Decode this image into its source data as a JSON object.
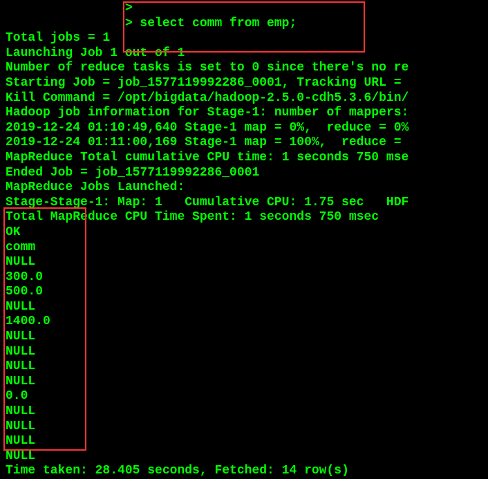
{
  "terminal": {
    "prompt1": "                >",
    "prompt2": "                > select comm from emp;",
    "lines": [
      "Total jobs = 1",
      "Launching Job 1 out of 1",
      "Number of reduce tasks is set to 0 since there's no re",
      "Starting Job = job_1577119992286_0001, Tracking URL = ",
      "Kill Command = /opt/bigdata/hadoop-2.5.0-cdh5.3.6/bin/",
      "Hadoop job information for Stage-1: number of mappers:",
      "2019-12-24 01:10:49,640 Stage-1 map = 0%,  reduce = 0%",
      "2019-12-24 01:11:00,169 Stage-1 map = 100%,  reduce = ",
      "MapReduce Total cumulative CPU time: 1 seconds 750 mse",
      "Ended Job = job_1577119992286_0001",
      "MapReduce Jobs Launched:",
      "Stage-Stage-1: Map: 1   Cumulative CPU: 1.75 sec   HDF",
      "Total MapReduce CPU Time Spent: 1 seconds 750 msec",
      "OK"
    ],
    "result_header": "comm",
    "results": [
      "NULL",
      "300.0",
      "500.0",
      "NULL",
      "1400.0",
      "NULL",
      "NULL",
      "NULL",
      "NULL",
      "0.0",
      "NULL",
      "NULL",
      "NULL",
      "NULL"
    ],
    "footer": "Time taken: 28.405 seconds, Fetched: 14 row(s)"
  }
}
